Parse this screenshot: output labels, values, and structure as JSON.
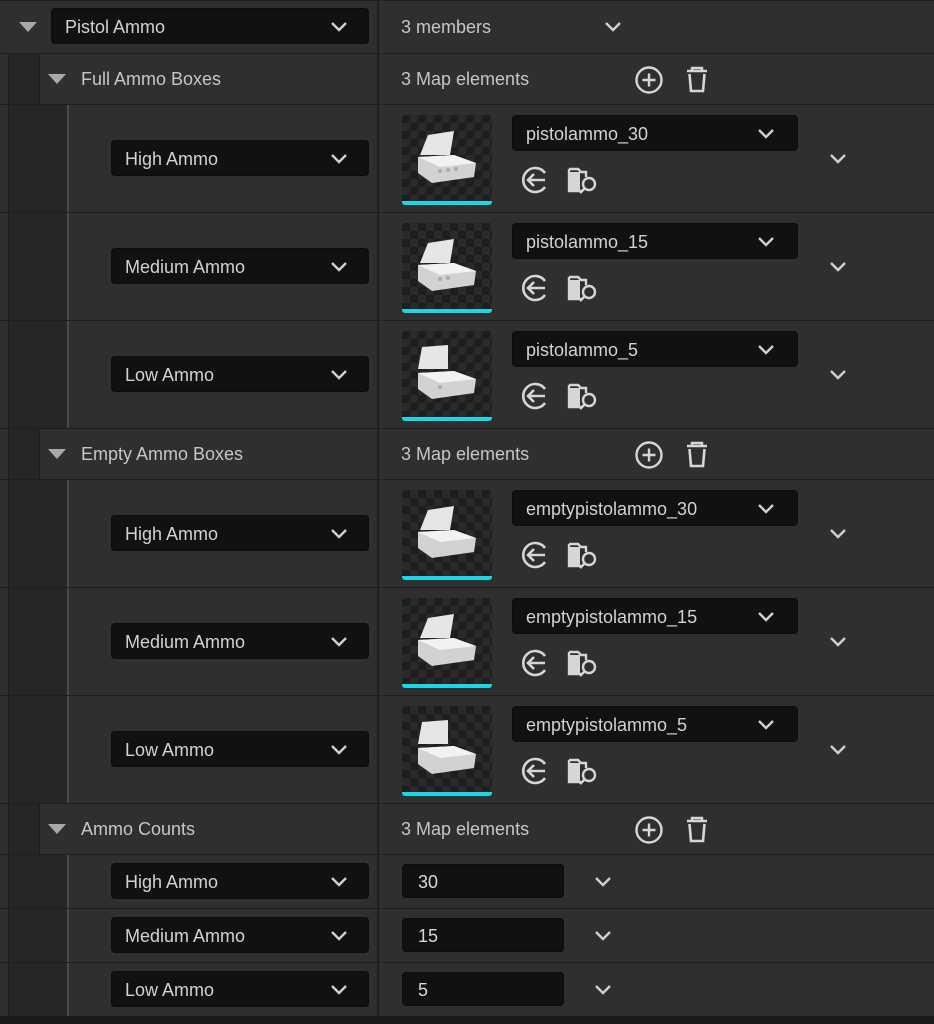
{
  "top": {
    "struct_select": "Pistol Ammo",
    "members": "3 members"
  },
  "groups": [
    {
      "label": "Full Ammo Boxes",
      "count": "3 Map elements",
      "entries": [
        {
          "key": "High Ammo",
          "asset": "pistolammo_30"
        },
        {
          "key": "Medium Ammo",
          "asset": "pistolammo_15"
        },
        {
          "key": "Low Ammo",
          "asset": "pistolammo_5"
        }
      ]
    },
    {
      "label": "Empty Ammo Boxes",
      "count": "3 Map elements",
      "entries": [
        {
          "key": "High Ammo",
          "asset": "emptypistolammo_30"
        },
        {
          "key": "Medium Ammo",
          "asset": "emptypistolammo_15"
        },
        {
          "key": "Low Ammo",
          "asset": "emptypistolammo_5"
        }
      ]
    },
    {
      "label": "Ammo Counts",
      "count": "3 Map elements",
      "entries": [
        {
          "key": "High Ammo",
          "value": "30"
        },
        {
          "key": "Medium Ammo",
          "value": "15"
        },
        {
          "key": "Low Ammo",
          "value": "5"
        }
      ]
    }
  ],
  "icons": {
    "expand": "triangle-down-icon",
    "dropdown": "chevron-down-icon",
    "add": "plus-circle-icon",
    "delete": "trash-icon",
    "use_selected": "arrow-left-circle-icon",
    "browse": "folder-search-icon"
  },
  "colors": {
    "thumbnail_underline": "#19d7e6"
  }
}
